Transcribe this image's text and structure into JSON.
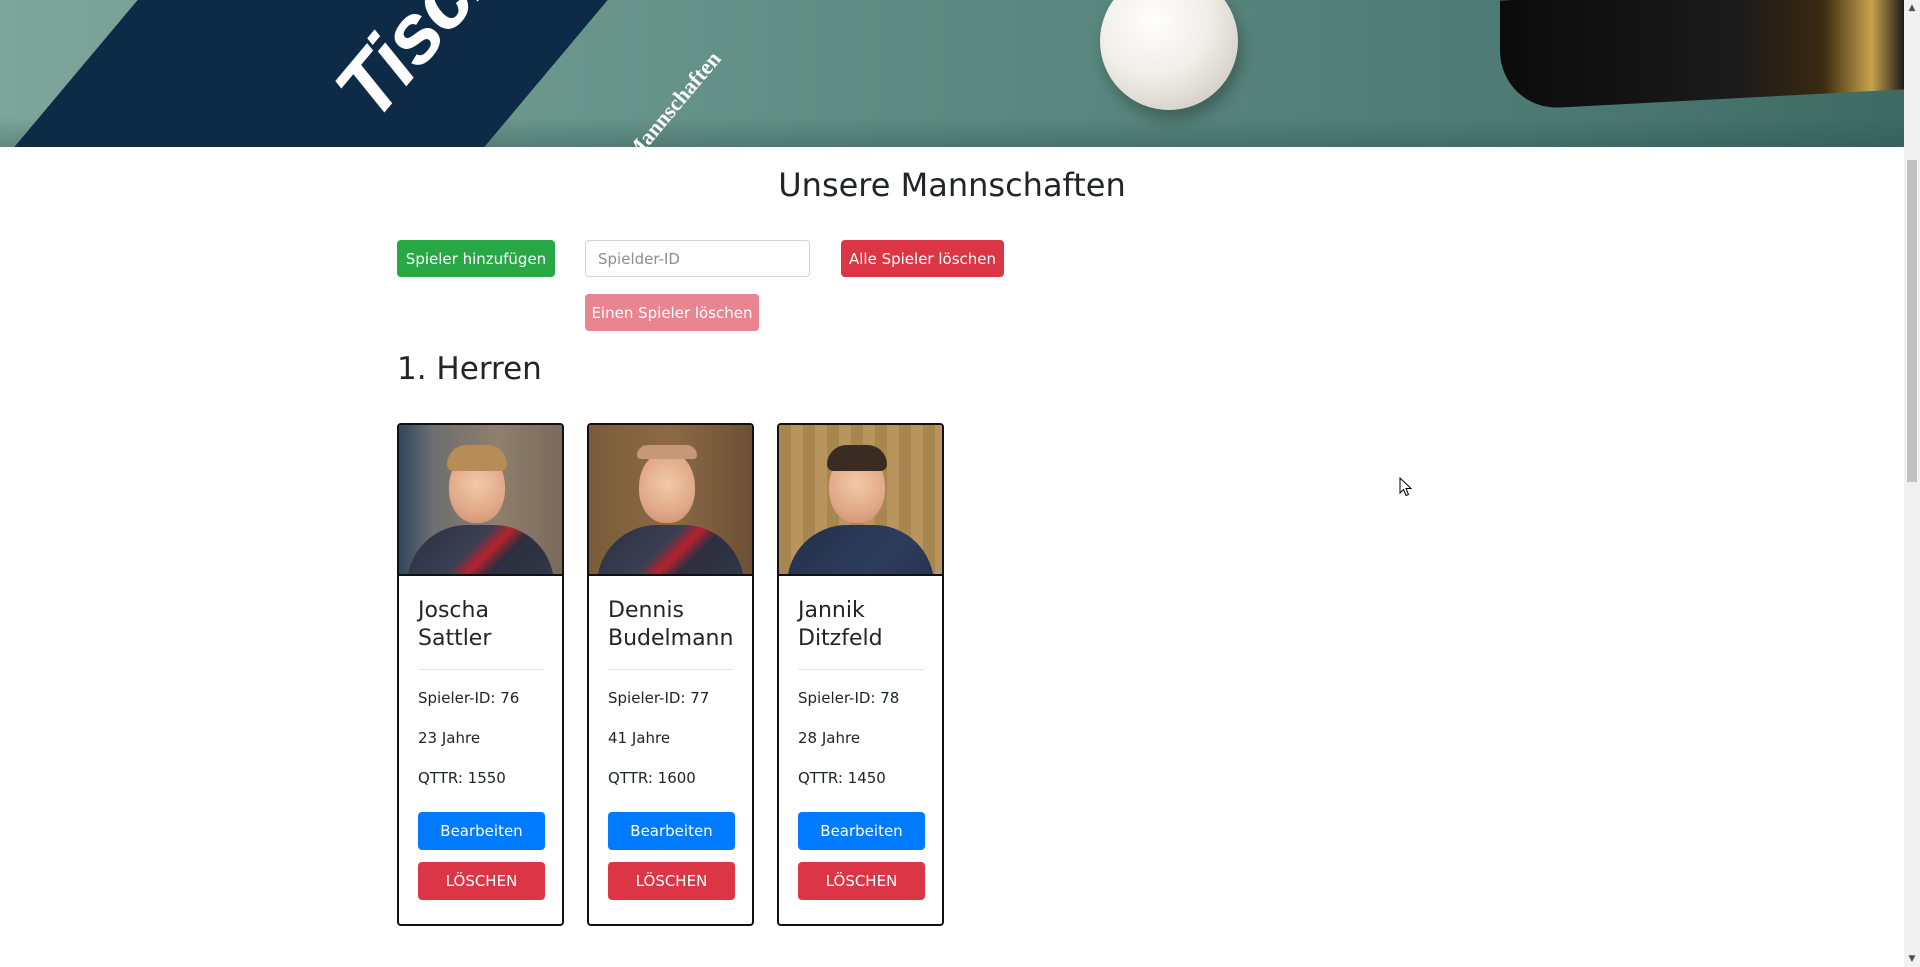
{
  "header": {
    "banner_text_main": "Tisch",
    "banner_text_sub": "Mannschaften"
  },
  "main": {
    "title": "Unsere Mannschaften",
    "toolbar": {
      "add_player_label": "Spieler hinzufügen",
      "player_id_placeholder": "Spielder-ID",
      "player_id_value": "",
      "delete_all_label": "Alle Spieler löschen",
      "delete_one_label": "Einen Spieler löschen"
    },
    "teams": [
      {
        "name": "1. Herren",
        "players": [
          {
            "first_name": "Joscha",
            "last_name": "Sattler",
            "id_text": "Spieler-ID: 76",
            "age_text": "23 Jahre",
            "qttr_text": "QTTR: 1550",
            "edit_label": "Bearbeiten",
            "delete_label": "LÖSCHEN"
          },
          {
            "first_name": "Dennis",
            "last_name": "Budelmann",
            "id_text": "Spieler-ID: 77",
            "age_text": "41 Jahre",
            "qttr_text": "QTTR: 1600",
            "edit_label": "Bearbeiten",
            "delete_label": "LÖSCHEN"
          },
          {
            "first_name": "Jannik",
            "last_name": "Ditzfeld",
            "id_text": "Spieler-ID: 78",
            "age_text": "28 Jahre",
            "qttr_text": "QTTR: 1450",
            "edit_label": "Bearbeiten",
            "delete_label": "LÖSCHEN"
          }
        ]
      }
    ]
  },
  "colors": {
    "success": "#28a745",
    "danger": "#dc3545",
    "danger_disabled": "#e98590",
    "primary": "#007bff",
    "banner_blue": "#0d2a47",
    "table_green": "#5d8a80"
  },
  "icons": {
    "scroll_up": "▲",
    "scroll_down": "▼"
  }
}
